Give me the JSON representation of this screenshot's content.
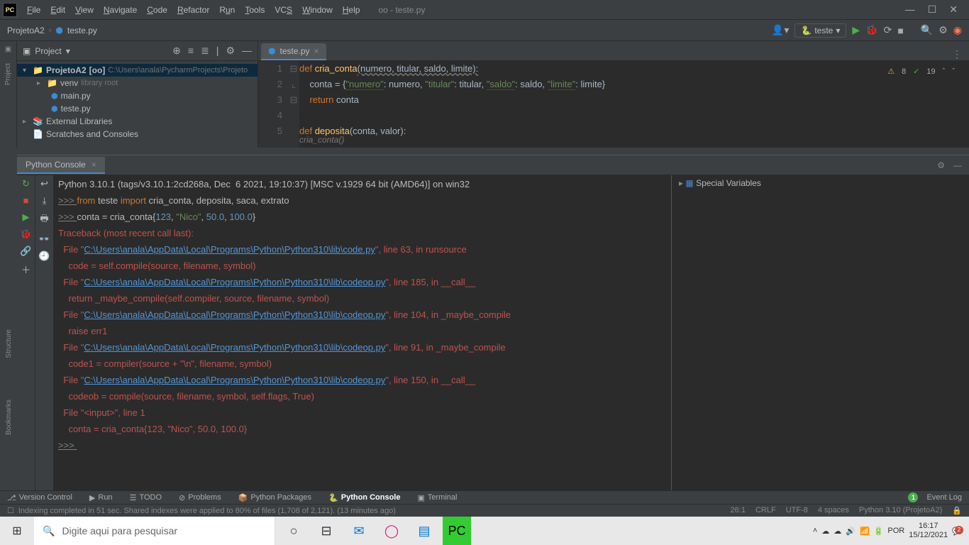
{
  "titlebar": {
    "title": "oo - teste.py"
  },
  "menus": [
    "File",
    "Edit",
    "View",
    "Navigate",
    "Code",
    "Refactor",
    "Run",
    "Tools",
    "VCS",
    "Window",
    "Help"
  ],
  "breadcrumb": {
    "project": "ProjetoA2",
    "file": "teste.py"
  },
  "run_config": {
    "label": "teste"
  },
  "project_panel": {
    "title": "Project"
  },
  "tree": {
    "root": {
      "name": "ProjetoA2",
      "tag": "[oo]",
      "path": "C:\\Users\\anala\\PycharmProjects\\Projeto"
    },
    "venv": {
      "name": "venv",
      "hint": "library root"
    },
    "main": "main.py",
    "teste": "teste.py",
    "extlib": "External Libraries",
    "scratch": "Scratches and Consoles"
  },
  "editor": {
    "tab": "teste.py",
    "indicators": {
      "warn_icon": "⚠",
      "warn": "8",
      "check_icon": "✓",
      "check": "19"
    },
    "lines": [
      "1",
      "2",
      "3",
      "4",
      "5"
    ],
    "hint": "cria_conta()"
  },
  "code": {
    "l1": {
      "def": "def ",
      "fn": "cria_conta",
      "args": "(numero, titular, saldo, limite):"
    },
    "l2": {
      "pre": "    conta = {",
      "k1": "\"numero\"",
      "c1": ": numero, ",
      "k2": "\"titular\"",
      "c2": ": titular, ",
      "k3": "\"saldo\"",
      "c3": ": saldo, ",
      "k4": "\"limite\"",
      "c4": ": limite}"
    },
    "l3": {
      "ret": "    return ",
      "var": "conta"
    },
    "l5": {
      "def": "def ",
      "fn": "deposita",
      "args": "(conta, valor):"
    }
  },
  "console": {
    "tab": "Python Console",
    "vars_label": "Special Variables",
    "header": "Python 3.10.1 (tags/v3.10.1:2cd268a, Dec  6 2021, 19:10:37) [MSC v.1929 64 bit (AMD64)] on win32",
    "in1": {
      "p": ">>> ",
      "k": "from ",
      "m": "teste ",
      "k2": "import ",
      "rest": "cria_conta, deposita, saca, extrato"
    },
    "in2": {
      "p": ">>> ",
      "pre": "conta = cria_conta{",
      "n1": "123",
      "c1": ", ",
      "s1": "\"Nico\"",
      "c2": ", ",
      "n2": "50.0",
      "c3": ", ",
      "n3": "100.0",
      "post": "}"
    },
    "tb": "Traceback (most recent call last):",
    "f1a": "  File \"",
    "f1b": "C:\\Users\\anala\\AppData\\Local\\Programs\\Python\\Python310\\lib\\code.py",
    "f1c": "\", line 63, in runsource",
    "f1d": "    code = self.compile(source, filename, symbol)",
    "f2a": "  File \"",
    "f2b": "C:\\Users\\anala\\AppData\\Local\\Programs\\Python\\Python310\\lib\\codeop.py",
    "f2c": "\", line 185, in __call__",
    "f2d": "    return _maybe_compile(self.compiler, source, filename, symbol)",
    "f3a": "  File \"",
    "f3c": "\", line 104, in ",
    "f3d": "_maybe_compile",
    "f3e": "    raise err1",
    "f4a": "  File \"",
    "f4c": "\", line 91, in ",
    "f4d": "_maybe_compile",
    "f4e": "    code1 = compiler(source + \"\\n\", filename, symbol)",
    "f5a": "  File \"",
    "f5c": "\", line 150, in __call__",
    "f5d": "    codeob = compile(source, filename, symbol, self.flags, True)",
    "f6": "  File \"<input>\", line 1",
    "f6b": "    conta = cria_conta{123, \"Nico\", 50.0, 100.0}",
    "p3": ">>> "
  },
  "tools": {
    "vcs": "Version Control",
    "run": "Run",
    "todo": "TODO",
    "problems": "Problems",
    "packages": "Python Packages",
    "console": "Python Console",
    "terminal": "Terminal",
    "eventlog": "Event Log"
  },
  "status": {
    "msg": "Indexing completed in 51 sec. Shared indexes were applied to 80% of files (1,708 of 2,121). (13 minutes ago)",
    "pos": "26:1",
    "sep": "CRLF",
    "enc": "UTF-8",
    "indent": "4 spaces",
    "interp": "Python 3.10 (ProjetoA2)"
  },
  "left_tabs": {
    "project": "Project",
    "structure": "Structure",
    "bookmarks": "Bookmarks"
  },
  "taskbar": {
    "search_placeholder": "Digite aqui para pesquisar",
    "lang": "POR",
    "time": "16:17",
    "date": "15/12/2021"
  }
}
